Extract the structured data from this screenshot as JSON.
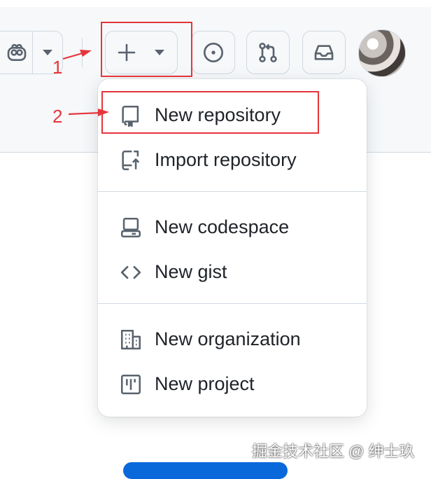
{
  "header": {
    "buttons": [
      {
        "id": "copilot",
        "icon": "copilot-icon"
      },
      {
        "id": "copilot-menu",
        "icon": "triangle-down-icon"
      },
      {
        "id": "create-new",
        "icon": "plus-icon"
      },
      {
        "id": "issues",
        "icon": "issue-opened-icon"
      },
      {
        "id": "pull-requests",
        "icon": "git-pull-request-icon"
      },
      {
        "id": "inbox",
        "icon": "inbox-icon"
      }
    ]
  },
  "create_menu": {
    "items": [
      {
        "label": "New repository",
        "icon": "repo-icon"
      },
      {
        "label": "Import repository",
        "icon": "repo-push-icon"
      },
      {
        "label": "New codespace",
        "icon": "codespaces-icon"
      },
      {
        "label": "New gist",
        "icon": "code-icon"
      },
      {
        "label": "New organization",
        "icon": "organization-icon"
      },
      {
        "label": "New project",
        "icon": "project-icon"
      }
    ]
  },
  "annotations": {
    "step1": "1",
    "step2": "2",
    "color": "#e5353b"
  },
  "watermark": "掘金技术社区 @ 绅士玖",
  "colors": {
    "header_bg": "#f6f8fa",
    "border": "#d1d9e0",
    "text": "#1f2328",
    "icon": "#59636e",
    "primary_button": "#0969da"
  }
}
